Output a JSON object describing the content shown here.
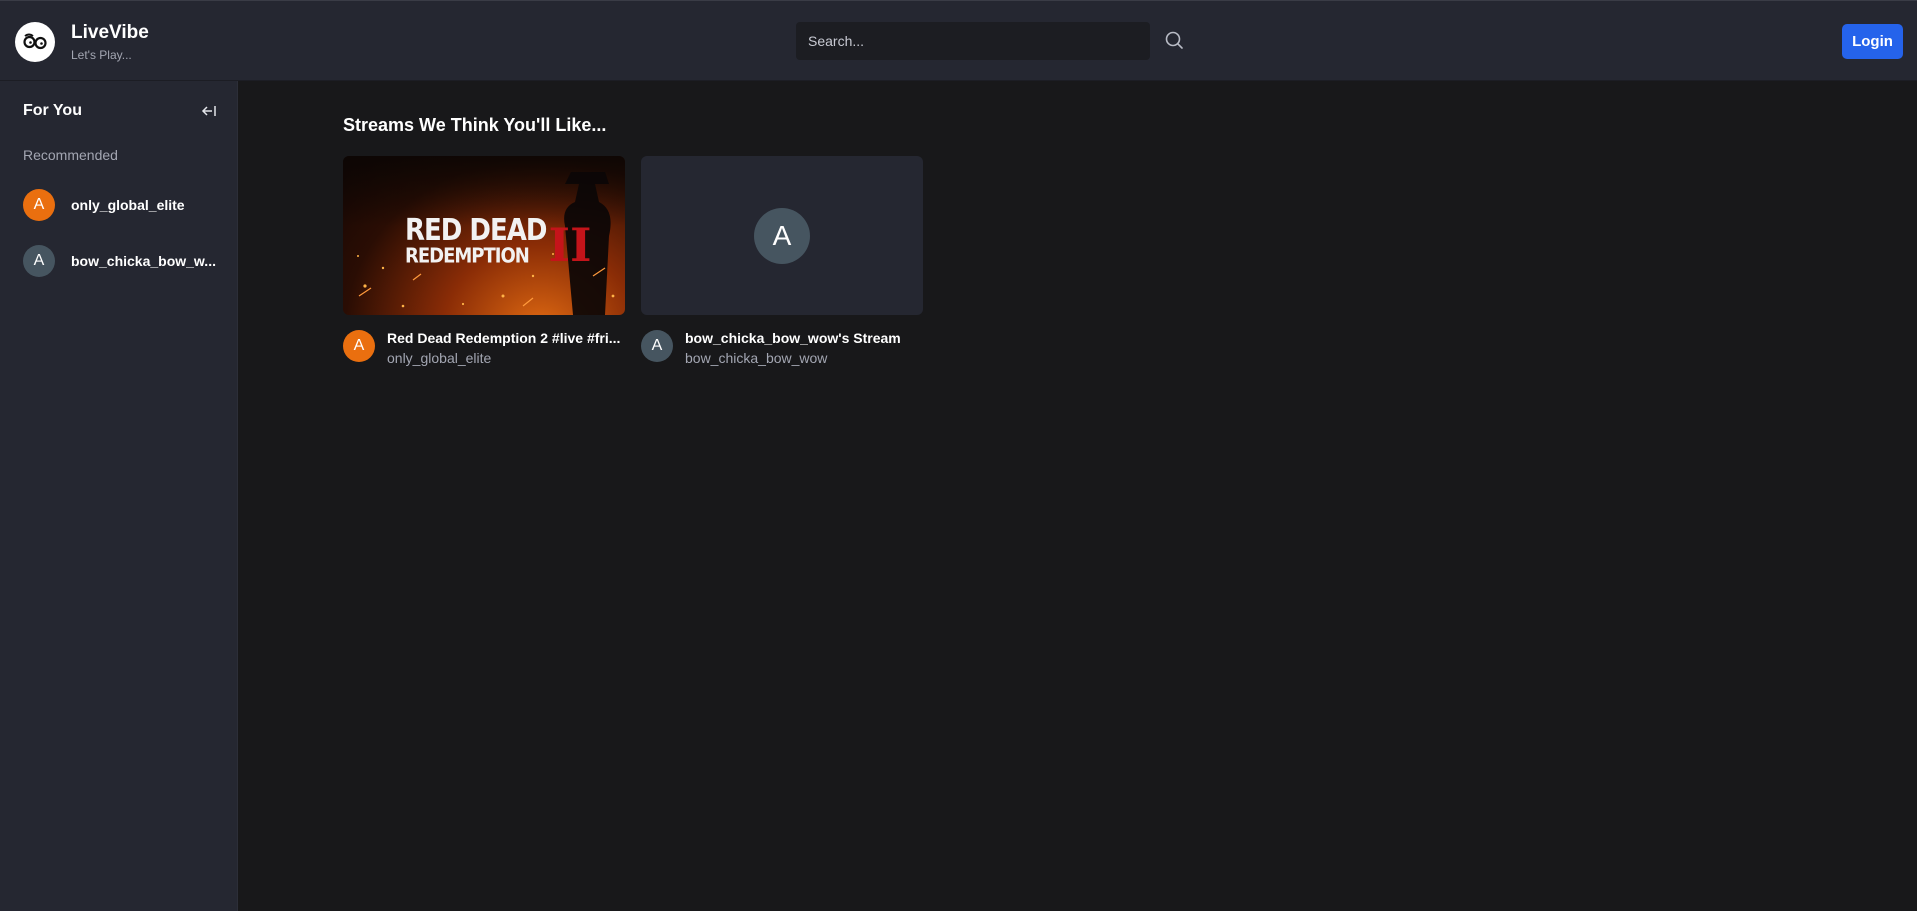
{
  "app": {
    "name": "LiveVibe",
    "tagline": "Let's Play..."
  },
  "header": {
    "search_placeholder": "Search...",
    "search_value": "",
    "login_label": "Login"
  },
  "sidebar": {
    "title": "For You",
    "section_label": "Recommended",
    "items": [
      {
        "avatar_letter": "A",
        "label": "only_global_elite",
        "avatar_color": "#ea6f0f"
      },
      {
        "avatar_letter": "A",
        "label": "bow_chicka_bow_w...",
        "avatar_color": "#465560"
      }
    ]
  },
  "main": {
    "title": "Streams We Think You'll Like...",
    "streams": [
      {
        "title": "Red Dead Redemption 2 #live #fri...",
        "user": "only_global_elite",
        "avatar_letter": "A",
        "thumbnail_text_line1": "RED DEAD",
        "thumbnail_text_line2": "REDEMPTION",
        "thumbnail_numeral": "II"
      },
      {
        "title": "bow_chicka_bow_wow's Stream",
        "user": "bow_chicka_bow_wow",
        "avatar_letter": "A",
        "thumbnail_avatar_letter": "A"
      }
    ]
  },
  "colors": {
    "accent": "#2563eb",
    "avatar_orange": "#ea6f0f",
    "avatar_slate": "#465560"
  }
}
